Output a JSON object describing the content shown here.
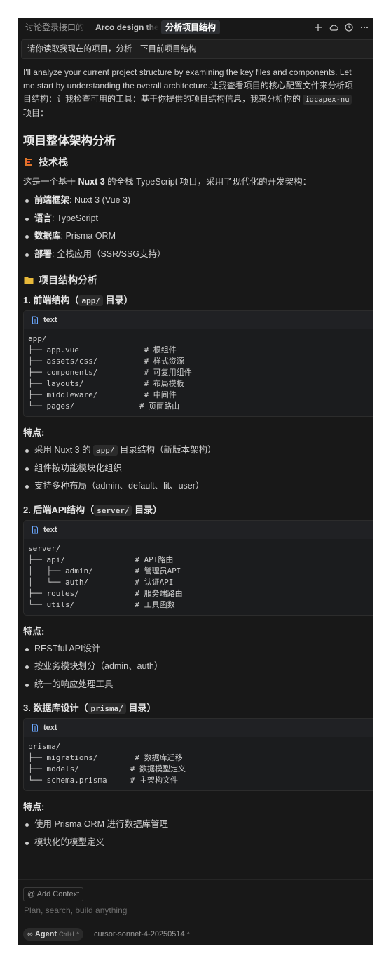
{
  "tabs": [
    {
      "label": "讨论登录接口的",
      "active": false
    },
    {
      "label": "Arco design the",
      "active": false
    },
    {
      "label": "分析项目结构",
      "active": true
    }
  ],
  "tabbar_icons": [
    "plus-icon",
    "cloud-icon",
    "history-icon",
    "more-icon"
  ],
  "user_prompt": "请你读取我现在的项目，分析一下目前项目结构",
  "assistant": {
    "intro_line1": "I'll analyze your current project structure by examining the key files and components. Let",
    "intro_line2": "me start by understanding the overall architecture.让我查看项目的核心配置文件来分析项",
    "intro_line3_pre": "目结构：让我检查可用的工具：基于你提供的项目结构信息，我来分析你的 ",
    "intro_code": "idcapex-nu",
    "intro_line4": "项目：",
    "heading": "项目整体架构分析",
    "tech_stack": {
      "title": "技术栈",
      "summary_pre": "这是一个基于 ",
      "summary_bold": "Nuxt 3",
      "summary_post": " 的全栈 TypeScript 项目，采用了现代化的开发架构：",
      "items": [
        {
          "key": "前端框架",
          "value": ": Nuxt 3 (Vue 3)"
        },
        {
          "key": "语言",
          "value": ": TypeScript"
        },
        {
          "key": "数据库",
          "value": ": Prisma ORM"
        },
        {
          "key": "部署",
          "value": ": 全栈应用（SSR/SSG支持）"
        }
      ]
    },
    "structure": {
      "title": "项目结构分析",
      "sections": [
        {
          "heading_pre": "1. 前端结构（",
          "heading_code": "app/",
          "heading_post": " 目录）",
          "code_lang": "text",
          "code": "app/\n├── app.vue              # 根组件\n├── assets/css/          # 样式资源\n├── components/          # 可复用组件\n├── layouts/             # 布局模板\n├── middleware/          # 中间件\n└── pages/              # 页面路由",
          "features_label": "特点:",
          "features": [
            {
              "pre": "采用 Nuxt 3 的 ",
              "code": "app/",
              "post": " 目录结构（新版本架构）"
            },
            {
              "pre": "组件按功能模块化组织",
              "code": "",
              "post": ""
            },
            {
              "pre": "支持多种布局（admin、default、lit、user）",
              "code": "",
              "post": ""
            }
          ]
        },
        {
          "heading_pre": "2. 后端API结构（",
          "heading_code": "server/",
          "heading_post": " 目录）",
          "code_lang": "text",
          "code": "server/\n├── api/               # API路由\n│   ├── admin/         # 管理员API\n│   └── auth/          # 认证API\n├── routes/            # 服务端路由\n└── utils/             # 工具函数",
          "features_label": "特点:",
          "features": [
            {
              "pre": "RESTful API设计",
              "code": "",
              "post": ""
            },
            {
              "pre": "按业务模块划分（admin、auth）",
              "code": "",
              "post": ""
            },
            {
              "pre": "统一的响应处理工具",
              "code": "",
              "post": ""
            }
          ]
        },
        {
          "heading_pre": "3. 数据库设计（",
          "heading_code": "prisma/",
          "heading_post": " 目录）",
          "code_lang": "text",
          "code": "prisma/\n├── migrations/        # 数据库迁移\n├── models/           # 数据模型定义\n└── schema.prisma     # 主架构文件",
          "features_label": "特点:",
          "features": [
            {
              "pre": "使用 Prisma ORM 进行数据库管理",
              "code": "",
              "post": ""
            },
            {
              "pre": "模块化的模型定义",
              "code": "",
              "post": ""
            }
          ]
        }
      ]
    }
  },
  "composer": {
    "add_context": "@ Add Context",
    "placeholder": "Plan, search, build anything",
    "agent_label": "Agent",
    "agent_shortcut": "Ctrl+I",
    "model": "cursor-sonnet-4-20250514"
  },
  "colors": {
    "background": "#181818",
    "panel": "#1b1c1e",
    "text": "#cccccc",
    "folder_icon": "#e8b93a",
    "stack_icon": "#e0762b"
  }
}
